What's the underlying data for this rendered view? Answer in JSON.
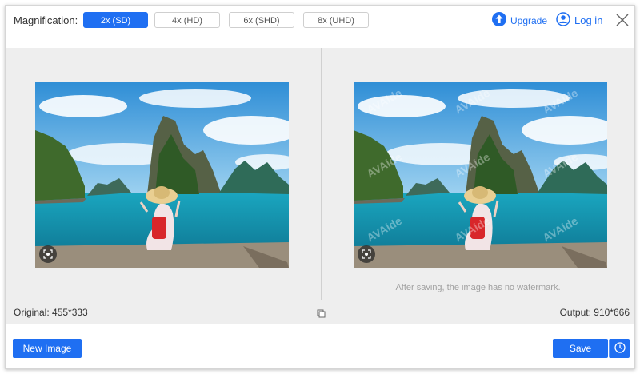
{
  "header": {
    "magnification_label": "Magnification:",
    "options": [
      {
        "label": "2x (SD)",
        "selected": true
      },
      {
        "label": "4x (HD)",
        "selected": false
      },
      {
        "label": "6x (SHD)",
        "selected": false
      },
      {
        "label": "8x (UHD)",
        "selected": false
      }
    ],
    "upgrade_label": "Upgrade",
    "login_label": "Log in"
  },
  "preview": {
    "watermark_text": "AVAide",
    "no_watermark_note": "After saving, the image has no watermark."
  },
  "infobar": {
    "original": "Original: 455*333",
    "output": "Output: 910*666"
  },
  "footer": {
    "new_image_label": "New Image",
    "save_label": "Save"
  },
  "colors": {
    "accent": "#1f6ff2",
    "pane_bg": "#eeeeee"
  }
}
